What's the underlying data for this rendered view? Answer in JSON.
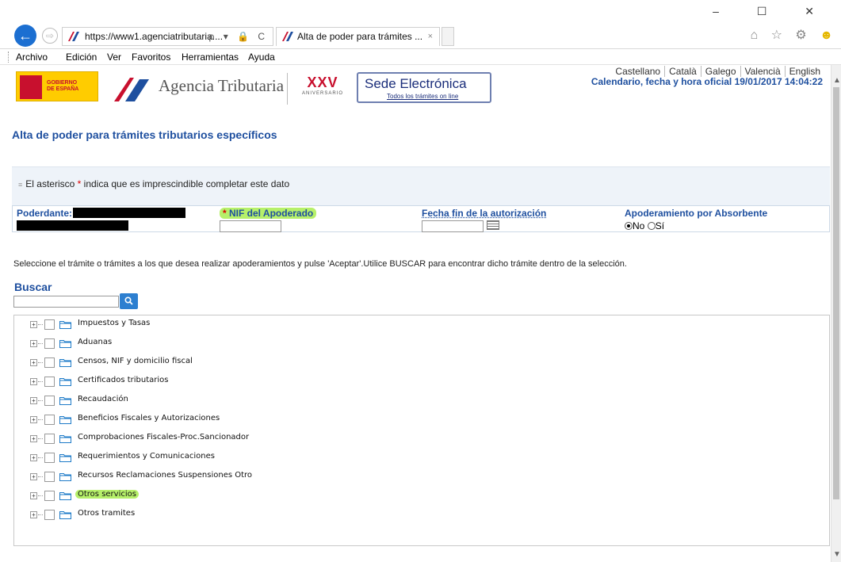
{
  "browser": {
    "url": "https://www1.agenciatributaria....",
    "address_tools": "ρ ▾ 🔒 C",
    "tab_title": "Alta de poder para trámites ...",
    "tab_close": "×",
    "window_controls": "– ☐ ✕",
    "icons": "⌂ ☆ ⚙",
    "menu": [
      "Archivo",
      "Edición",
      "Ver",
      "Favoritos",
      "Herramientas",
      "Ayuda"
    ]
  },
  "header": {
    "gobierno": "GOBIERNO\nDE ESPAÑA",
    "agency_name": "Agencia Tributaria",
    "xxv": "XXV",
    "aniversario": "ANIVERSARIO",
    "sede_title": "Sede Electrónica",
    "sede_subtitle": "Todos los trámites on line",
    "languages": [
      "Castellano",
      "Català",
      "Galego",
      "Valencià",
      "English"
    ],
    "calendar": "Calendario, fecha y hora oficial 19/01/2017 14:04:22"
  },
  "page_title": "Alta de poder para trámites tributarios específicos",
  "form": {
    "note_prefix": "El asterisco",
    "note_star": "*",
    "note_suffix": "indica que es imprescindible completar este dato",
    "poderdante_label": "Poderdante:",
    "nif_star": "*",
    "nif_label": "NIF del Apoderado",
    "fecha_label": "Fecha fin de la autorización",
    "apod_label": "Apoderamiento por Absorbente",
    "radio_no": "No",
    "radio_si": "Sí",
    "selected_radio": "No"
  },
  "instruction": "Seleccione el trámite o trámites a los que desea realizar apoderamientos y pulse 'Aceptar'.Utilice BUSCAR para encontrar dicho trámite dentro de la selección.",
  "search": {
    "label": "Buscar",
    "button": "🔍"
  },
  "tree": [
    "Impuestos y Tasas",
    "Aduanas",
    "Censos, NIF y domicilio fiscal",
    "Certificados tributarios",
    "Recaudación",
    "Beneficios Fiscales y Autorizaciones",
    "Comprobaciones Fiscales-Proc.Sancionador",
    "Requerimientos y Comunicaciones",
    "Recursos Reclamaciones Suspensiones Otro",
    "Otros servicios",
    "Otros tramites"
  ],
  "highlighted_item": "Otros servicios",
  "colors": {
    "accent_blue": "#1e4f9f",
    "highlight_green": "#b6f06a",
    "required_red": "#d00000"
  }
}
